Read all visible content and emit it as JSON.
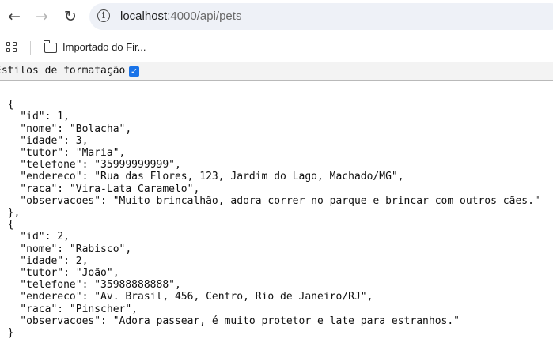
{
  "browser": {
    "url_host": "localhost",
    "url_path": ":4000/api/pets",
    "back_icon": "arrow-left-icon",
    "forward_icon": "arrow-right-icon",
    "reload_icon": "reload-icon",
    "info_icon": "info-icon"
  },
  "bookmarks": {
    "folder_label": "Importado do Fir..."
  },
  "pretty_print": {
    "label": "Estilos de formatação",
    "checked": true
  },
  "json_lines": [
    "[",
    "  {",
    "    \"id\": 1,",
    "    \"nome\": \"Bolacha\",",
    "    \"idade\": 3,",
    "    \"tutor\": \"Maria\",",
    "    \"telefone\": \"35999999999\",",
    "    \"endereco\": \"Rua das Flores, 123, Jardim do Lago, Machado/MG\",",
    "    \"raca\": \"Vira-Lata Caramelo\",",
    "    \"observacoes\": \"Muito brincalhão, adora correr no parque e brincar com outros cães.\"",
    "  },",
    "  {",
    "    \"id\": 2,",
    "    \"nome\": \"Rabisco\",",
    "    \"idade\": 2,",
    "    \"tutor\": \"João\",",
    "    \"telefone\": \"35988888888\",",
    "    \"endereco\": \"Av. Brasil, 456, Centro, Rio de Janeiro/RJ\",",
    "    \"raca\": \"Pinscher\",",
    "    \"observacoes\": \"Adora passear, é muito protetor e late para estranhos.\"",
    "  }"
  ]
}
